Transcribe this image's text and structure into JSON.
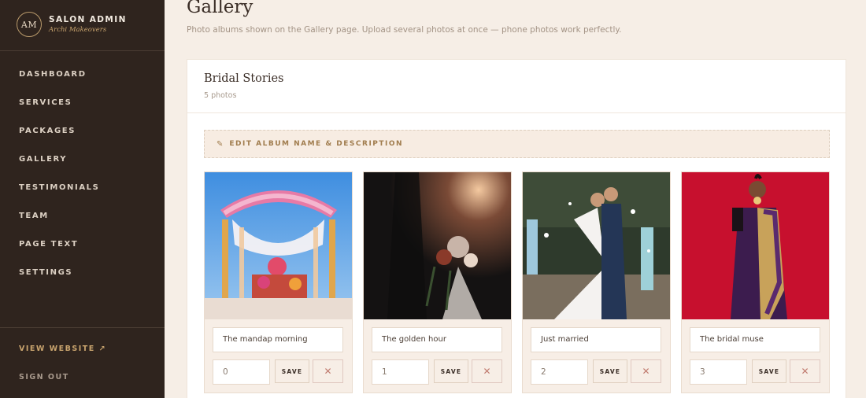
{
  "brand": {
    "monogram": "AM",
    "title": "SALON ADMIN",
    "subtitle": "Archi Makeovers"
  },
  "nav": [
    {
      "label": "DASHBOARD"
    },
    {
      "label": "SERVICES"
    },
    {
      "label": "PACKAGES"
    },
    {
      "label": "GALLERY"
    },
    {
      "label": "TESTIMONIALS"
    },
    {
      "label": "TEAM"
    },
    {
      "label": "PAGE TEXT"
    },
    {
      "label": "SETTINGS"
    }
  ],
  "footer_nav": {
    "view_website": "VIEW WEBSITE ↗",
    "sign_out": "SIGN OUT"
  },
  "page": {
    "title": "Gallery",
    "subtitle": "Photo albums shown on the Gallery page. Upload several photos at once — phone photos work perfectly."
  },
  "album": {
    "name": "Bridal Stories",
    "count": "5 photos",
    "edit_label": "EDIT ALBUM NAME & DESCRIPTION",
    "edit_icon": "pencil-icon",
    "photos": [
      {
        "caption": "The mandap morning",
        "order": "0",
        "save": "SAVE",
        "delete": "✕"
      },
      {
        "caption": "The golden hour",
        "order": "1",
        "save": "SAVE",
        "delete": "✕"
      },
      {
        "caption": "Just married",
        "order": "2",
        "save": "SAVE",
        "delete": "✕"
      },
      {
        "caption": "The bridal muse",
        "order": "3",
        "save": "SAVE",
        "delete": "✕"
      }
    ]
  },
  "colors": {
    "sidebar_bg": "#2f241e",
    "page_bg": "#f6eee6",
    "accent_gold": "#c9a46e",
    "delete_red": "#c07a6e"
  }
}
